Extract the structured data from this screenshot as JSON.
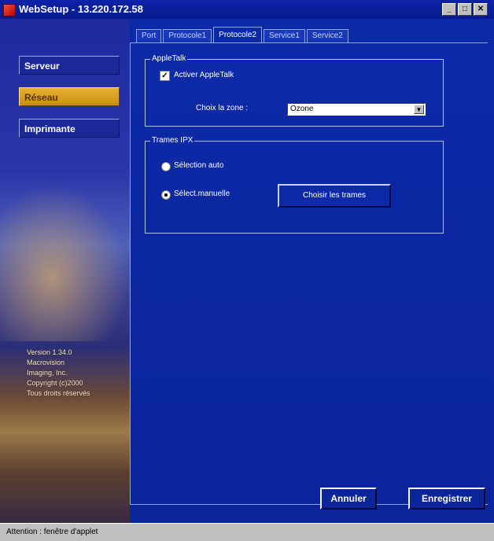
{
  "window": {
    "title": "WebSetup - 13.220.172.58",
    "buttons": [
      "_",
      "□",
      "✕"
    ]
  },
  "sidebar": {
    "items": [
      {
        "label": "Serveur",
        "active": false
      },
      {
        "label": "Réseau",
        "active": true
      },
      {
        "label": "Imprimante",
        "active": false
      }
    ],
    "version_lines": [
      "Version 1.34.0",
      "Macrovision",
      "Imaging, Inc.",
      "Copyright (c)2000",
      "Tous droits réservés"
    ]
  },
  "tabs": [
    {
      "label": "Port",
      "active": false
    },
    {
      "label": "Protocole1",
      "active": false
    },
    {
      "label": "Protocole2",
      "active": true
    },
    {
      "label": "Service1",
      "active": false
    },
    {
      "label": "Service2",
      "active": false
    }
  ],
  "appletalk": {
    "group_title": "AppleTalk",
    "checkbox_label": "Activer AppleTalk",
    "checked": true,
    "zone_label": "Choix la zone :",
    "zone_value": "Ozone"
  },
  "ipx": {
    "group_title": "Trames IPX",
    "radio_auto_label": "Sélection auto",
    "radio_manual_label": "Sélect.manuelle",
    "selected": "manual",
    "choose_button": "Choisir les trames"
  },
  "footer": {
    "cancel": "Annuler",
    "save": "Enregistrer"
  },
  "status": {
    "text": "Attention : fenêtre d'applet"
  },
  "colors": {
    "panel_blue": "#0c2aa8",
    "active_nav": "#e8b030"
  }
}
